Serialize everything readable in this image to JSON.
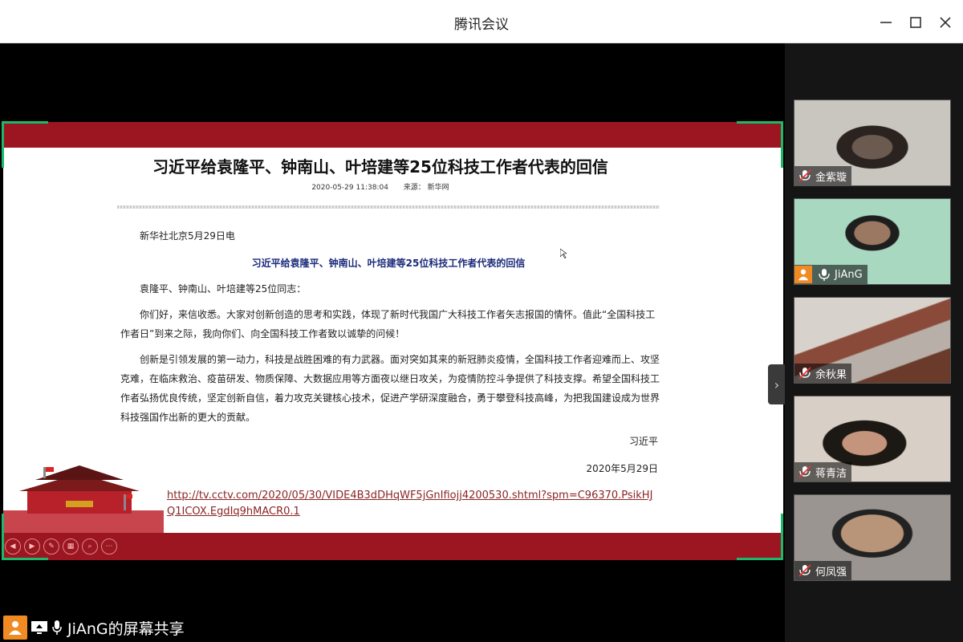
{
  "window": {
    "title": "腾讯会议"
  },
  "article": {
    "title": "习近平给袁隆平、钟南山、叶培建等25位科技工作者代表的回信",
    "datetime": "2020-05-29 11:38:04",
    "source": "来源： 新华网",
    "dateline": "新华社北京5月29日电",
    "subtitle": "习近平给袁隆平、钟南山、叶培建等25位科技工作者代表的回信",
    "greeting": "袁隆平、钟南山、叶培建等25位同志：",
    "paragraph1": "你们好，来信收悉。大家对创新创造的思考和实践，体现了新时代我国广大科技工作者矢志报国的情怀。值此“全国科技工作者日”到来之际，我向你们、向全国科技工作者致以诚挚的问候！",
    "paragraph2": "创新是引领发展的第一动力，科技是战胜困难的有力武器。面对突如其来的新冠肺炎疫情，全国科技工作者迎难而上、攻坚克难，在临床救治、疫苗研发、物质保障、大数据应用等方面夜以继日攻关，为疫情防控斗争提供了科技支撑。希望全国科技工作者弘扬优良传统，坚定创新自信，着力攻克关键核心技术，促进产学研深度融合，勇于攀登科技高峰，为把我国建设成为世界科技强国作出新的更大的贡献。",
    "signature": "习近平",
    "sign_date": "2020年5月29日",
    "link": "http://tv.cctv.com/2020/05/30/VIDE4B3dDHqWF5jGnIfiojj4200530.shtml?spm=C96370.PsikHJQ1ICOX.EgdIq9hMACR0.1"
  },
  "share": {
    "label": "JiAnG的屏幕共享"
  },
  "participants": [
    {
      "name": "金紫璇",
      "muted": true
    },
    {
      "name": "JiAnG",
      "muted": false,
      "host_avatar": true
    },
    {
      "name": "余秋果",
      "muted": true
    },
    {
      "name": "蒋青洁",
      "muted": true
    },
    {
      "name": "何凤强",
      "muted": true
    }
  ],
  "colors": {
    "slide_band": "#9b1620",
    "share_frame": "#1db86a",
    "avatar": "#f08a22",
    "subtitle": "#1a2a7a",
    "link": "#8a2424"
  },
  "icons": [
    "minimize-icon",
    "maximize-icon",
    "close-icon",
    "mic-muted-icon",
    "mic-icon",
    "user-avatar-icon",
    "screen-share-icon",
    "chevron-right-icon"
  ]
}
